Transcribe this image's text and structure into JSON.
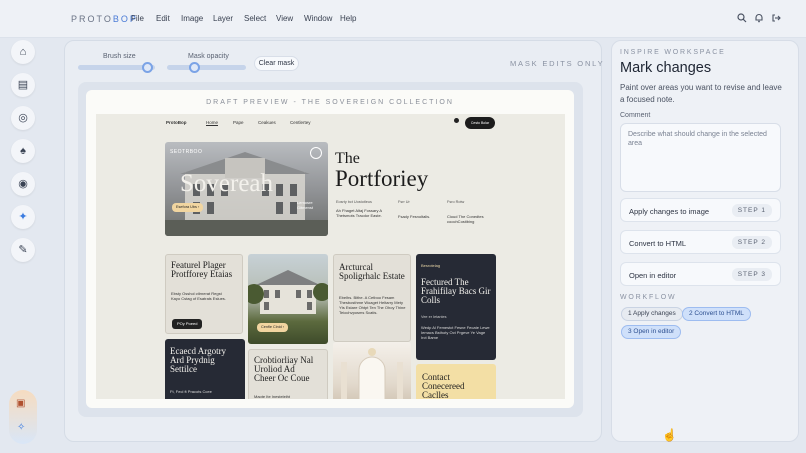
{
  "app": {
    "logo_main": "PROTO",
    "logo_accent": "BOP"
  },
  "menu": [
    "File",
    "Edit",
    "Image",
    "Layer",
    "Select",
    "View",
    "Window",
    "Help"
  ],
  "topbar_icons": [
    "search-icon",
    "bell-icon",
    "logout-icon"
  ],
  "sidebar": {
    "tools": [
      "home-icon",
      "document-icon",
      "palette-icon",
      "rocket-icon",
      "eye-icon",
      "sparkle-icon",
      "brush-icon"
    ],
    "bottom": [
      "image-icon",
      "sparkle-icon"
    ]
  },
  "controls": {
    "brush_label": "Brush size",
    "brush_value": 0.9,
    "opacity_label": "Mask opacity",
    "opacity_value": 0.35,
    "clear_label": "Clear mask",
    "mask_badge": "MASK EDITS ONLY"
  },
  "preview": {
    "title": "DRAFT PREVIEW - THE SOVEREIGN COLLECTION",
    "site": {
      "brand": "ProtoBop",
      "nav": [
        "Home",
        "Pape",
        "Ceakues",
        "Centlertey"
      ],
      "cta": "Cesto Bolar",
      "hero_tag": "SEOTRBOO",
      "hero_word": "Sovereah",
      "hero_caption": "Lemosre Gitmenst",
      "hero_button": "Esefora Ubs ›",
      "headline_1": "The",
      "headline_2": "Portforiey",
      "col_heads": [
        "Eosrty bct Uostotleus",
        "Fsrr Ur",
        "Fsro Rotw"
      ],
      "col_texts": [
        "Ah Fhaget Altaj Fossary A Thetsmots Tracdor Easte.",
        "Fsady Fesnoltalis.",
        "Cioud The Conedtes coochCostibing"
      ],
      "cards": [
        {
          "title": "Featurel Plager Protfforey Etaias",
          "text": "Ebsty Osshol ctlrnerat Regst Kayo Cstag of Esatrals Eslues.",
          "button": "POy Poeed"
        },
        {
          "title": "Arcturcal Spoligrhalc Estate",
          "text": "Ebelhs. Bithe. A Cetboo Fesam Thesbosthme Woaget Heltarry Mety Yts Estare Ohtpt Ten The Ohoy Thine Teiochvposms Scatis."
        },
        {
          "badge": "Besrotelag",
          "title": "Fectured The Frahifilay Bacs Gir Colls",
          "text": "Wedp Al Femestct Fesne Fecate Lewe Iemacs Bsthoty Oct Prgeve Ye Vage Irct Bame",
          "button": "Vee er Ietantes"
        },
        {
          "title": "Ecaecd Argotry Ard Prydnig Settilce",
          "text": "Ft, Fecl ft Pracots Ccee"
        },
        {
          "title": "Crobtiorliay Nal Uroliod Ad Cheer Oc Coue",
          "text": "Maote Ite Inesteleiht"
        },
        {
          "title": "Contact Conecereed Caclles"
        }
      ],
      "villa_button": "Cenfle Cinid ›"
    }
  },
  "panel": {
    "section": "INSPIRE WORKSPACE",
    "title": "Mark changes",
    "description": "Paint over areas you want to revise and leave a focused note.",
    "comment_label": "Comment",
    "comment_placeholder": "Describe what should change in the selected area",
    "actions": [
      {
        "label": "Apply changes to image",
        "step": "STEP 1"
      },
      {
        "label": "Convert to HTML",
        "step": "STEP 2"
      },
      {
        "label": "Open in editor",
        "step": "STEP 3"
      }
    ],
    "workflow_label": "WORKFLOW",
    "chips": [
      "1 Apply changes",
      "2 Convert to HTML",
      "3 Open in editor"
    ]
  }
}
